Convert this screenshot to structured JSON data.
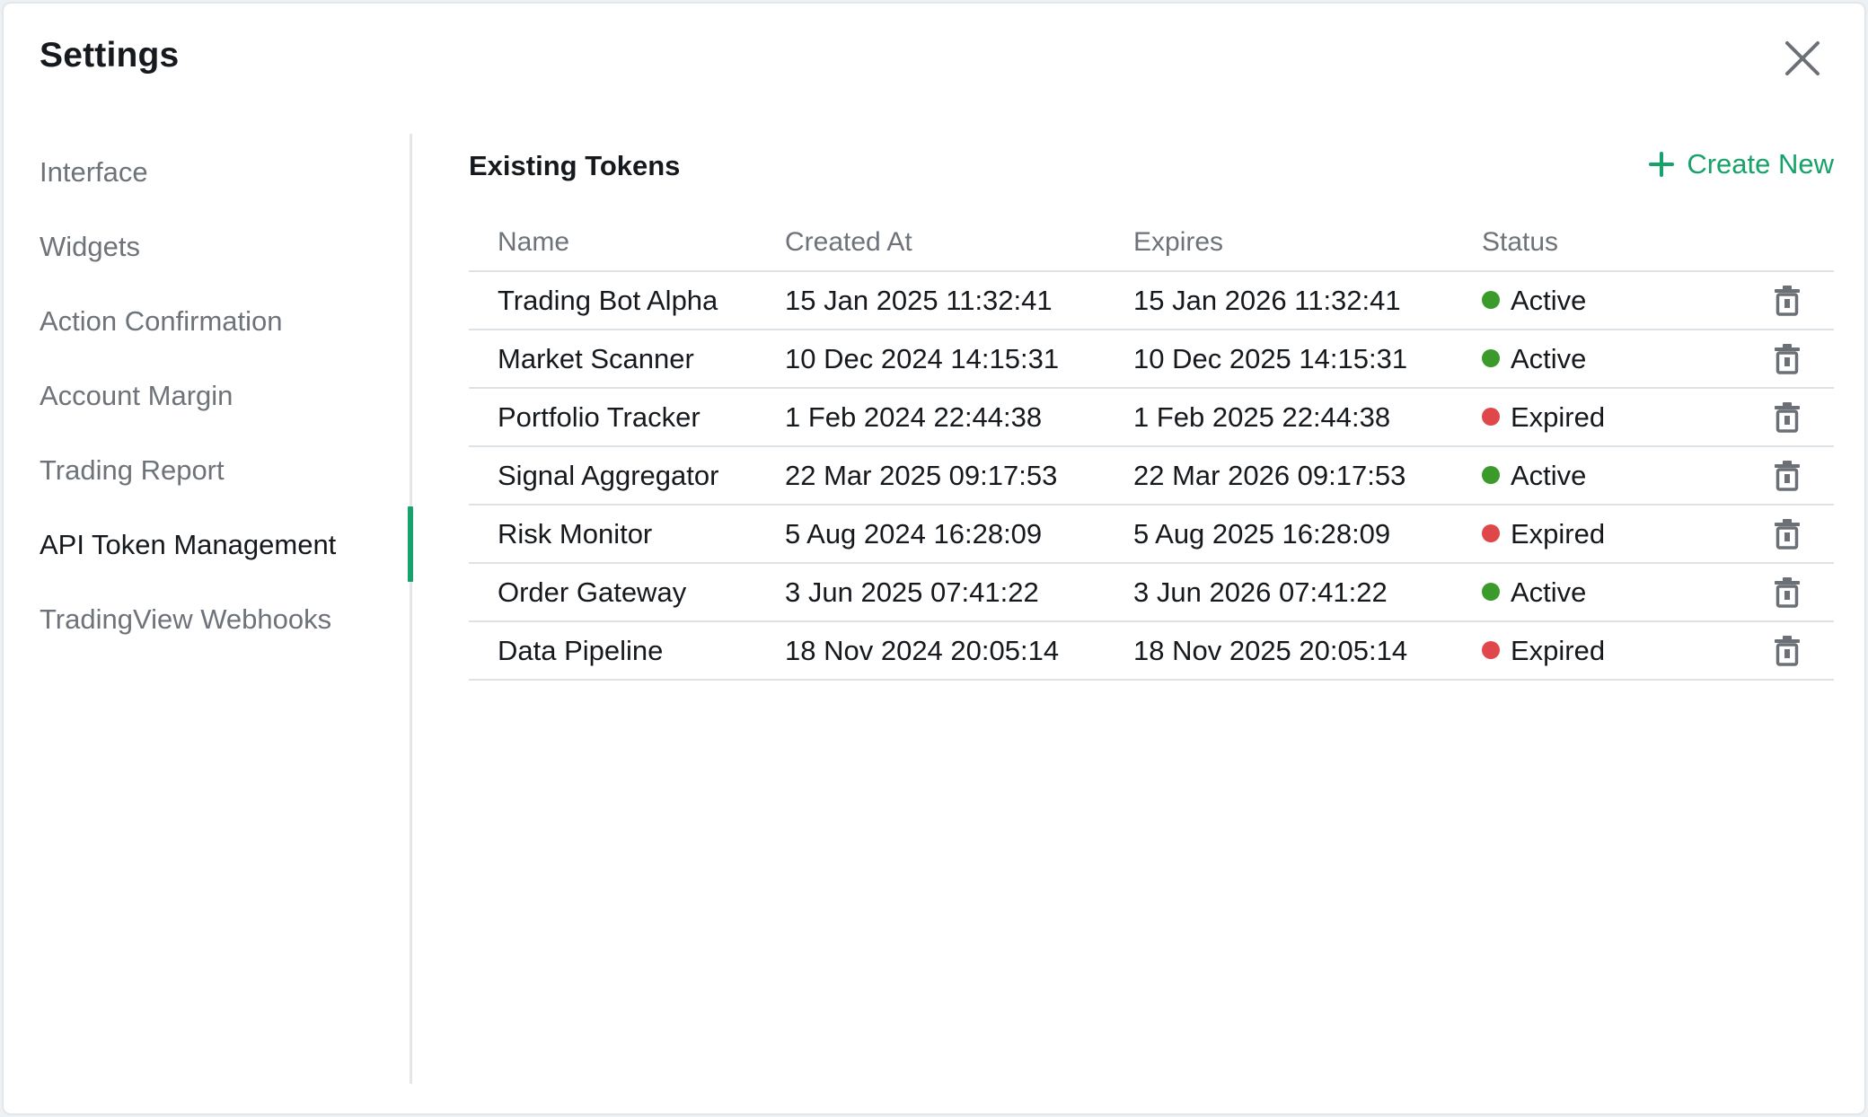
{
  "dialog": {
    "title": "Settings"
  },
  "sidebar": {
    "items": [
      {
        "label": "Interface"
      },
      {
        "label": "Widgets"
      },
      {
        "label": "Action Confirmation"
      },
      {
        "label": "Account Margin"
      },
      {
        "label": "Trading Report"
      },
      {
        "label": "API Token Management"
      },
      {
        "label": "TradingView Webhooks"
      }
    ],
    "active": "API Token Management"
  },
  "tokens": {
    "section_title": "Existing Tokens",
    "create_label": "Create New",
    "headers": {
      "name": "Name",
      "created": "Created At",
      "expires": "Expires",
      "status": "Status"
    },
    "rows": [
      {
        "name": "Trading Bot Alpha",
        "created": "15 Jan 2025 11:32:41",
        "expires": "15 Jan 2026 11:32:41",
        "status": "Active"
      },
      {
        "name": "Market Scanner",
        "created": "10 Dec 2024 14:15:31",
        "expires": "10 Dec 2025 14:15:31",
        "status": "Active"
      },
      {
        "name": "Portfolio Tracker",
        "created": "1 Feb 2024 22:44:38",
        "expires": "1 Feb 2025 22:44:38",
        "status": "Expired"
      },
      {
        "name": "Signal Aggregator",
        "created": "22 Mar 2025 09:17:53",
        "expires": "22 Mar 2026 09:17:53",
        "status": "Active"
      },
      {
        "name": "Risk Monitor",
        "created": "5 Aug 2024 16:28:09",
        "expires": "5 Aug 2025 16:28:09",
        "status": "Expired"
      },
      {
        "name": "Order Gateway",
        "created": "3 Jun 2025 07:41:22",
        "expires": "3 Jun 2026 07:41:22",
        "status": "Active"
      },
      {
        "name": "Data Pipeline",
        "created": "18 Nov 2024 20:05:14",
        "expires": "18 Nov 2025 20:05:14",
        "status": "Expired"
      }
    ]
  },
  "icons": {
    "close": "close-icon",
    "add": "plus-icon",
    "delete": "trash-icon",
    "status": "status-dot-icon"
  },
  "colors": {
    "accent": "#17a26b",
    "active": "#3a9a2a",
    "expired": "#e0474a",
    "muted_text": "#6d7378",
    "divider": "#dde2e6"
  }
}
